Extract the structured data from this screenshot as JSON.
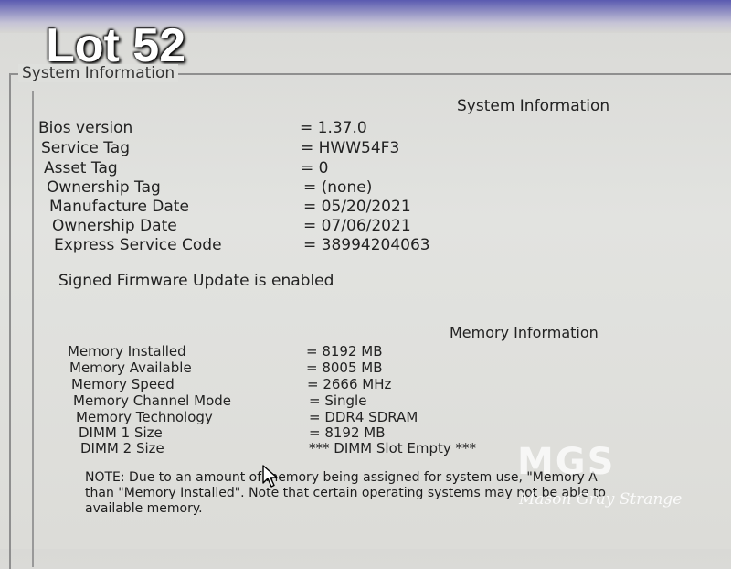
{
  "overlay": {
    "lot_label": "Lot 52"
  },
  "groupbox": {
    "title": "System Information"
  },
  "system_info": {
    "heading": "System Information",
    "rows": [
      {
        "label": "Bios version",
        "value": "= 1.37.0"
      },
      {
        "label": "Service Tag",
        "value": "= HWW54F3"
      },
      {
        "label": "Asset Tag",
        "value": "= 0"
      },
      {
        "label": "Ownership Tag",
        "value": "= (none)"
      },
      {
        "label": "Manufacture Date",
        "value": "= 05/20/2021"
      },
      {
        "label": "Ownership Date",
        "value": "= 07/06/2021"
      },
      {
        "label": "Express Service Code",
        "value": "= 38994204063"
      }
    ],
    "firmware_status": "Signed Firmware Update is enabled"
  },
  "memory_info": {
    "heading": "Memory Information",
    "rows": [
      {
        "label": "Memory Installed",
        "value": "= 8192 MB"
      },
      {
        "label": "Memory Available",
        "value": "= 8005 MB"
      },
      {
        "label": "Memory Speed",
        "value": "= 2666 MHz"
      },
      {
        "label": "Memory Channel Mode",
        "value": "= Single"
      },
      {
        "label": "Memory Technology",
        "value": "= DDR4 SDRAM"
      },
      {
        "label": "DIMM 1 Size",
        "value": "= 8192 MB"
      },
      {
        "label": "DIMM 2 Size",
        "value": "*** DIMM Slot Empty ***"
      }
    ],
    "note_lines": [
      "NOTE: Due to an amount of memory being assigned for system use, \"Memory A",
      "than \"Memory Installed\". Note that certain operating systems may not be able to",
      "available memory."
    ]
  },
  "watermark": {
    "logo": "MGS",
    "name": "Mason Gray Strange"
  },
  "icons": {
    "cursor": "mouse-pointer-icon"
  }
}
